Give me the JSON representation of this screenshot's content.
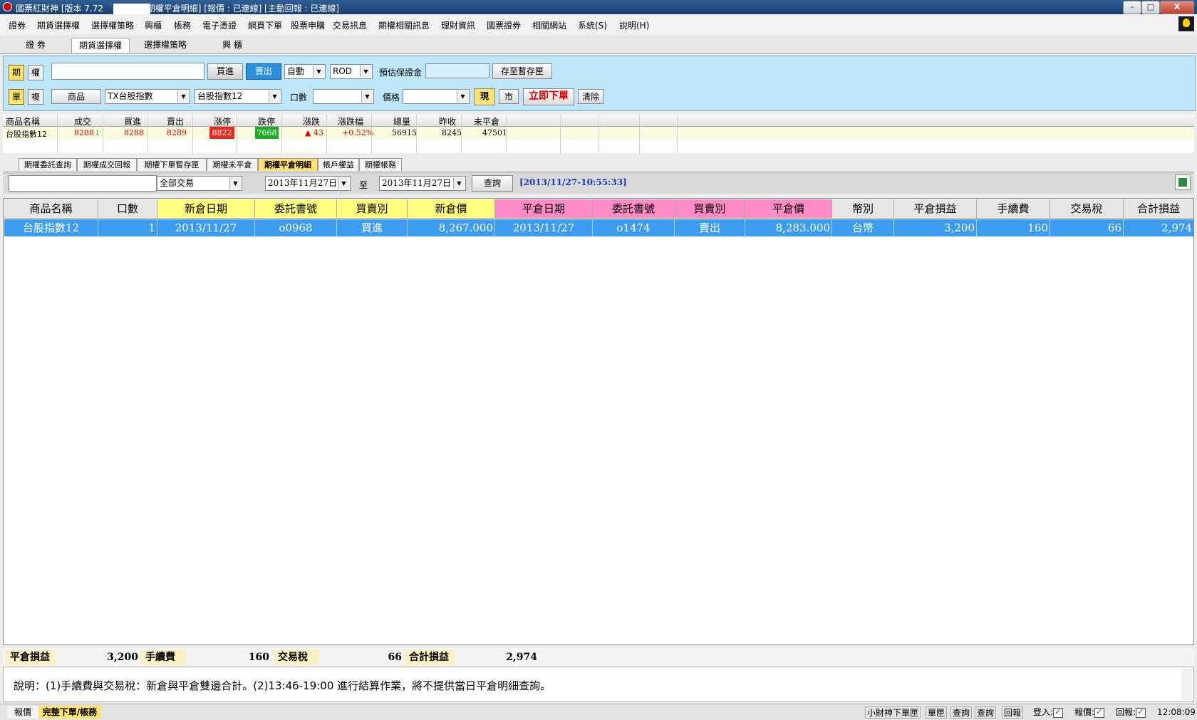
{
  "window": {
    "title": "國票紅財神 [版本 7.72",
    "title_suffix": "[期權平倉明細] [報價 : 已連線] [主動回報 : 已連線]",
    "minimize": "–",
    "maximize": "□",
    "close": "X"
  },
  "menu": [
    "證券",
    "期貨選擇權",
    "選擇權策略",
    "興櫃",
    "帳務",
    "電子憑證",
    "網頁下單",
    "股票申購",
    "交易訊息",
    "期權相關訊息",
    "理財資訊",
    "國票證券",
    "相關網站",
    "系統(S)",
    "說明(H)"
  ],
  "top_tabs": [
    "證 券",
    "期貨選擇權",
    "選擇權策略",
    "興 櫃"
  ],
  "top_tabs_active": 1,
  "order": {
    "toggle_fut": "期",
    "toggle_opt": "權",
    "toggle_single": "單",
    "toggle_combo": "複",
    "buy": "買進",
    "sell": "賣出",
    "mode": "自動",
    "order_type": "ROD",
    "margin_label": "預估保證金",
    "save_btn": "存至暫存匣",
    "product_btn": "商品",
    "product": "TX台股指數",
    "contract": "台股指數12",
    "qty_label": "口數",
    "price_label": "價格",
    "now_btn": "現",
    "mkt_btn": "市",
    "submit_btn": "立即下單",
    "clear_btn": "清除"
  },
  "quote": {
    "headers": [
      "商品名稱",
      "成交",
      "買進",
      "賣出",
      "漲停",
      "跌停",
      "漲跌",
      "漲跌幅",
      "總量",
      "昨收",
      "未平倉"
    ],
    "row": {
      "name": "台股指數12",
      "last": "8288",
      "last_arrow": "↓",
      "bid": "8288",
      "ask": "8289",
      "limit_up": "8822",
      "limit_down": "7668",
      "change": "43",
      "change_arrow": "▲",
      "change_pct": "+0.52%",
      "volume": "56915",
      "prev_close": "8245",
      "open_interest": "47501"
    },
    "colors": {
      "up": "#e00000",
      "limit_up_bg": "#e8291f",
      "limit_down_bg": "#1faa2a"
    }
  },
  "sub_tabs": [
    "期權委託查詢",
    "期權成交回報",
    "期權下單暫存匣",
    "期權未平倉",
    "期權平倉明細",
    "帳戶權益",
    "期權帳務"
  ],
  "sub_tabs_active": 4,
  "filter": {
    "trade_type": "全部交易",
    "date_from": "2013年11月27日",
    "to_label": "至",
    "date_to": "2013年11月27日",
    "query_btn": "查詢",
    "timestamp": "[2013/11/27-10:55:33]"
  },
  "table": {
    "headers": [
      "商品名稱",
      "口數",
      "新倉日期",
      "委託書號",
      "買賣別",
      "新倉價",
      "平倉日期",
      "委託書號",
      "買賣別",
      "平倉價",
      "幣別",
      "平倉損益",
      "手續費",
      "交易稅",
      "合計損益"
    ],
    "header_colors": {
      "new": "#ffff80",
      "close": "#ff8cc6",
      "plain": "#e6e6e6"
    },
    "rows": [
      [
        "台股指數12",
        "1",
        "2013/11/27",
        "o0968",
        "買進",
        "8,267.000",
        "2013/11/27",
        "o1474",
        "賣出",
        "8,283.000",
        "台幣",
        "3,200",
        "160",
        "66",
        "2,974"
      ]
    ]
  },
  "summary": {
    "pnl_label": "平倉損益",
    "pnl": "3,200",
    "fee_label": "手續費",
    "fee": "160",
    "tax_label": "交易稅",
    "tax": "66",
    "total_label": "合計損益",
    "total": "2,974"
  },
  "note": "說明：(1)手續費與交易稅：新倉與平倉雙邊合計。(2)13:46-19:00 進行結算作業，將不提供當日平倉明細查詢。",
  "statusbar": {
    "tab_quote": "報價",
    "tab_full": "完整下單/帳務",
    "items": [
      "小財神下單匣",
      "單匣",
      "查詢",
      "查詢",
      "回報"
    ],
    "login": "登入:",
    "quote": "報價:",
    "report": "回報:",
    "clock": "12:08:09"
  }
}
